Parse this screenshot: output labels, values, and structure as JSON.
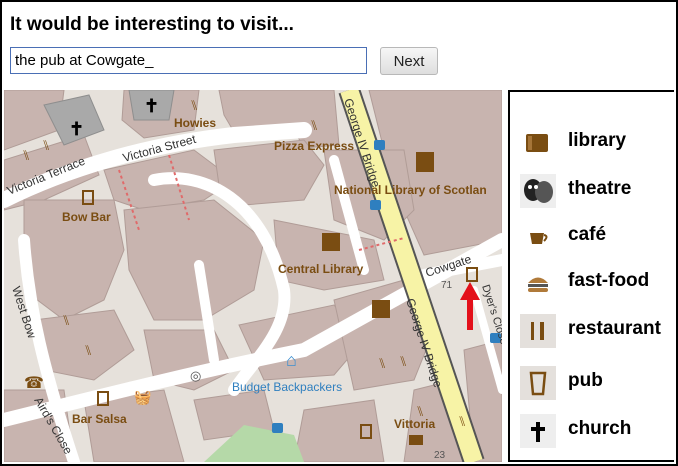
{
  "prompt": {
    "title": "It would be interesting to visit...",
    "input_value": "the pub at Cowgate_",
    "next_label": "Next"
  },
  "map": {
    "street_labels": [
      "Victoria Terrace",
      "Victoria Street",
      "George IV Bridge",
      "George IV Bridge",
      "Cowgate",
      "West Bow",
      "Dyer's Close",
      "Aird's Close"
    ],
    "place_labels": [
      "Howies",
      "Pizza Express",
      "National Library of Scotlan",
      "Bow Bar",
      "Central Library",
      "Budget Backpackers",
      "Bar Salsa",
      "Vittoria"
    ],
    "house_numbers": [
      "71",
      "23"
    ],
    "pointer": "red-arrow"
  },
  "legend": {
    "items": [
      {
        "label": "library",
        "icon": "library-icon"
      },
      {
        "label": "theatre",
        "icon": "theatre-icon"
      },
      {
        "label": "café",
        "icon": "cafe-icon"
      },
      {
        "label": "fast-food",
        "icon": "fast-food-icon"
      },
      {
        "label": "restaurant",
        "icon": "restaurant-icon"
      },
      {
        "label": "pub",
        "icon": "pub-icon"
      },
      {
        "label": "church",
        "icon": "church-icon"
      }
    ]
  },
  "colors": {
    "building": "#c9b5b0",
    "road": "#ffffff",
    "bridge": "#f7f3a6",
    "label_brown": "#7a4d12",
    "label_blue": "#2f7fbf",
    "arrow": "#e3101a"
  }
}
